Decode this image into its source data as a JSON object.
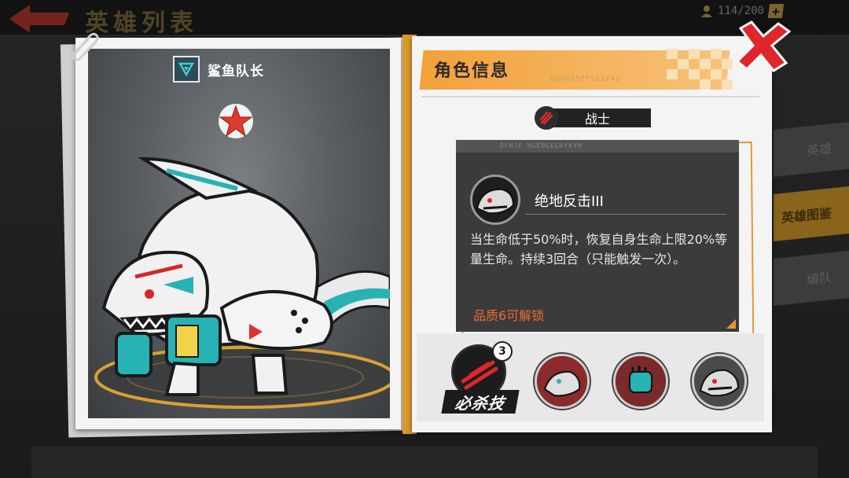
{
  "background": {
    "title": "英雄列表",
    "hero_count": "114/200",
    "plus_label": "+",
    "tabs": [
      {
        "label": "英雄",
        "active": false
      },
      {
        "label": "英雄图鉴",
        "active": true
      },
      {
        "label": "编队",
        "active": false
      }
    ]
  },
  "hero": {
    "name": "鲨鱼队长",
    "class_icon": "shield-v-icon",
    "rarity_icon": "red-star-icon"
  },
  "info": {
    "title": "角色信息",
    "subtitle": "GHHASSPFSAIPAS",
    "role": "战士",
    "close_icon": "close-x-icon"
  },
  "skill": {
    "header_code": "DFHJF HGEDGEGRYKYH",
    "name": "绝地反击III",
    "description": "当生命低于50%时，恢复自身生命上限20%等量生命。持续3回合（只能触发一次）。",
    "unlock": "品质6可解锁"
  },
  "skills_bar": {
    "ultimate_label": "必杀技",
    "ultimate_level": "3",
    "slots": [
      "shark-head-skill-icon",
      "fist-skill-icon",
      "shark-portrait-skill-icon"
    ]
  },
  "colors": {
    "accent": "#f3a13a",
    "close": "#e0262a",
    "unlock": "#ef6a3a",
    "teal": "#27b3b4"
  }
}
